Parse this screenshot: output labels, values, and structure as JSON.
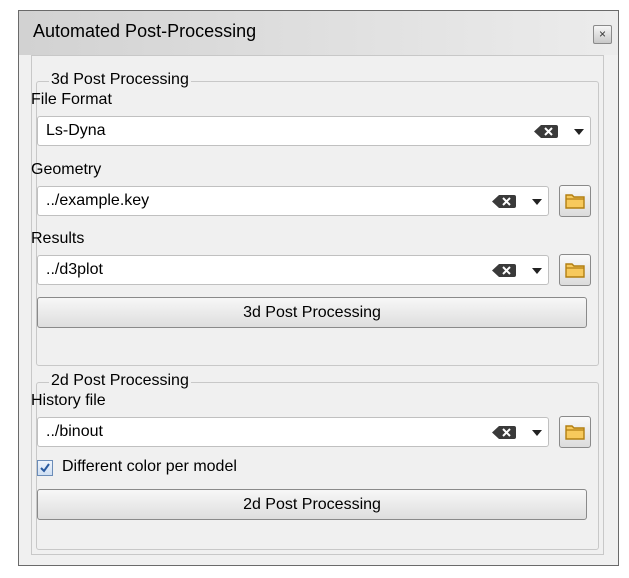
{
  "window": {
    "title": "Automated Post-Processing",
    "close_glyph": "×"
  },
  "group3d": {
    "title": "3d Post Processing",
    "file_format": {
      "label": "File Format",
      "value": "Ls-Dyna"
    },
    "geometry": {
      "label": "Geometry",
      "value": "../example.key"
    },
    "results": {
      "label": "Results",
      "value": "../d3plot"
    },
    "button": "3d Post Processing"
  },
  "group2d": {
    "title": "2d Post Processing",
    "history": {
      "label": "History file",
      "value": "../binout"
    },
    "checkbox": {
      "label": "Different color per model",
      "checked": true
    },
    "button": "2d Post Processing"
  },
  "icons": [
    "close-icon",
    "clear-text-icon",
    "chevron-down-icon",
    "folder-icon",
    "checkmark-icon"
  ],
  "colors": {
    "window_bg": "#f0f0f0",
    "folder_fill": "#f7c95c",
    "check_color": "#2a5aa0"
  }
}
